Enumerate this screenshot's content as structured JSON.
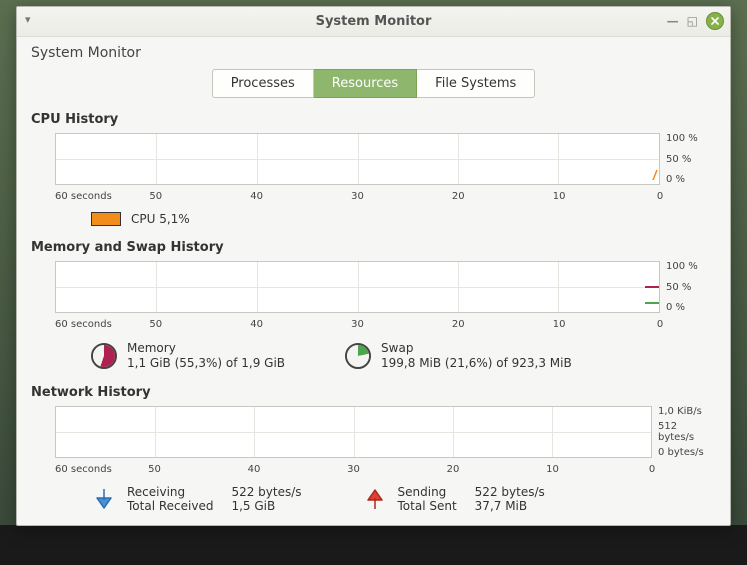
{
  "window": {
    "title": "System Monitor",
    "subtitle": "System Monitor"
  },
  "tabs": {
    "processes": "Processes",
    "resources": "Resources",
    "filesystems": "File Systems",
    "active": "resources"
  },
  "cpu": {
    "title": "CPU History",
    "legend_label": "CPU  5,1%",
    "swatch_color": "#f28c1a",
    "ylabels": [
      "100 %",
      "50 %",
      "0 %"
    ]
  },
  "time_axis": {
    "xlabels": [
      "60 seconds",
      "50",
      "40",
      "30",
      "20",
      "10",
      "0"
    ]
  },
  "memswap": {
    "title": "Memory and Swap History",
    "ylabels": [
      "100 %",
      "50 %",
      "0 %"
    ],
    "memory": {
      "label": "Memory",
      "detail": "1,1 GiB (55,3%) of 1,9 GiB",
      "percent": 55.3,
      "color": "#b02050"
    },
    "swap": {
      "label": "Swap",
      "detail": "199,8 MiB (21,6%) of 923,3 MiB",
      "percent": 21.6,
      "color": "#4ca64c"
    }
  },
  "network": {
    "title": "Network History",
    "ylabels": [
      "1,0 KiB/s",
      "512 bytes/s",
      "0 bytes/s"
    ],
    "receiving": {
      "label": "Receiving",
      "rate": "522 bytes/s",
      "total_label": "Total Received",
      "total": "1,5 GiB",
      "color": "#4a90d9"
    },
    "sending": {
      "label": "Sending",
      "rate": "522 bytes/s",
      "total_label": "Total Sent",
      "total": "37,7 MiB",
      "color": "#cc3030"
    }
  },
  "chart_data": [
    {
      "type": "line",
      "title": "CPU History",
      "x_unit": "seconds",
      "x_range": [
        60,
        0
      ],
      "series": [
        {
          "name": "CPU",
          "color": "#f28c1a",
          "current_percent": 5.1,
          "sampled_values_percent": [
            3,
            4,
            3,
            5,
            7,
            25
          ]
        }
      ],
      "ylabels": [
        "0 %",
        "50 %",
        "100 %"
      ],
      "ylim": [
        0,
        100
      ]
    },
    {
      "type": "line",
      "title": "Memory and Swap History",
      "x_unit": "seconds",
      "x_range": [
        60,
        0
      ],
      "series": [
        {
          "name": "Memory",
          "color": "#b02050",
          "current_percent": 55.3
        },
        {
          "name": "Swap",
          "color": "#4ca64c",
          "current_percent": 21.6
        }
      ],
      "ylabels": [
        "0 %",
        "50 %",
        "100 %"
      ],
      "ylim": [
        0,
        100
      ]
    },
    {
      "type": "line",
      "title": "Network History",
      "x_unit": "seconds",
      "x_range": [
        60,
        0
      ],
      "series": [
        {
          "name": "Receiving",
          "color": "#4a90d9",
          "current": "522 bytes/s"
        },
        {
          "name": "Sending",
          "color": "#cc3030",
          "current": "522 bytes/s"
        }
      ],
      "ylabels": [
        "0 bytes/s",
        "512 bytes/s",
        "1,0 KiB/s"
      ]
    }
  ]
}
